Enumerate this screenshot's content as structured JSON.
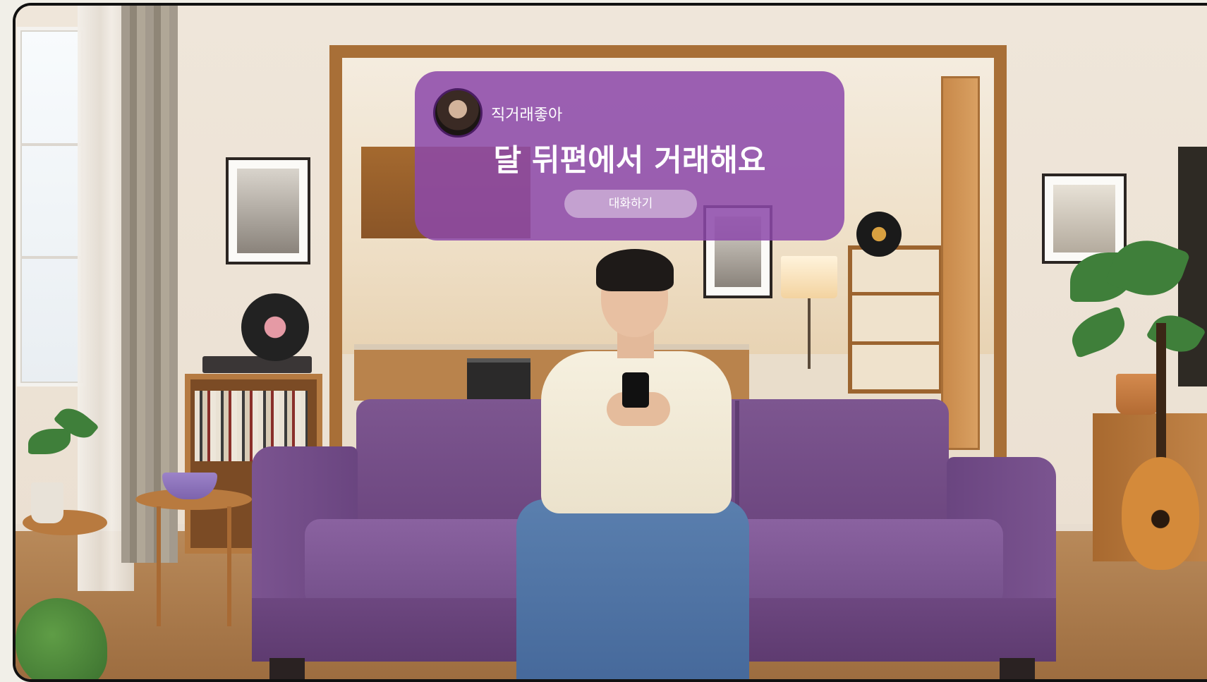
{
  "overlay_card": {
    "username": "직거래좋아",
    "headline": "달 뒤편에서 거래해요",
    "chat_button_label": "대화하기",
    "background_color": "#8c48aa",
    "avatar_icon": "profile-avatar"
  },
  "scene": {
    "sofa_color": "#7b5490",
    "accent_purple": "#8c48aa"
  }
}
